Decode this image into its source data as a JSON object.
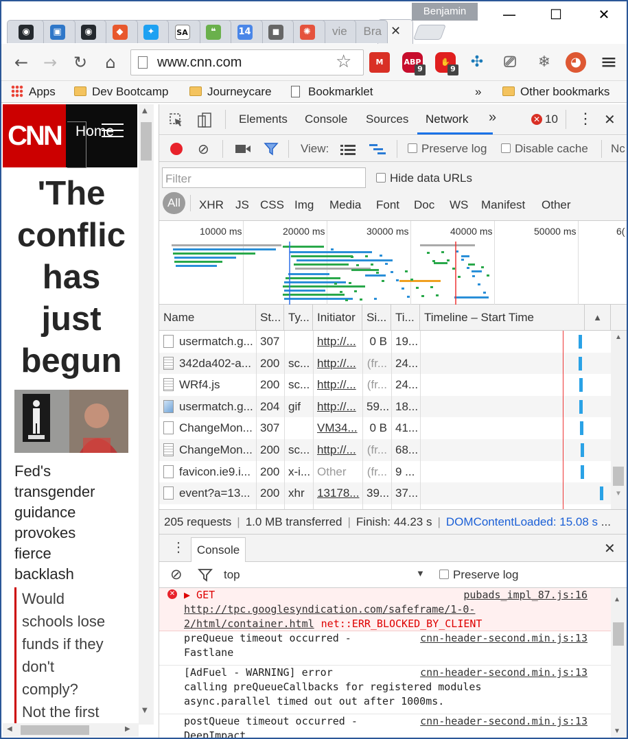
{
  "profile_name": "Benjamin",
  "window_controls": {
    "minimize": "—",
    "maximize": "☐",
    "close": "✕"
  },
  "tabs": [
    {
      "icon": "github-icon",
      "glyph": "◉",
      "color": "#24292e"
    },
    {
      "icon": "blue-app-icon",
      "glyph": "▣",
      "color": "#2f77c8"
    },
    {
      "icon": "github-icon",
      "glyph": "◉",
      "color": "#24292e"
    },
    {
      "icon": "git-icon",
      "glyph": "◆",
      "color": "#e8582d"
    },
    {
      "icon": "twitter-icon",
      "glyph": "✦",
      "color": "#1da1f2"
    },
    {
      "icon": "sa-icon",
      "glyph": "SA",
      "color": "#ffffff"
    },
    {
      "icon": "hangouts-icon",
      "glyph": "❝",
      "color": "#6ab04c"
    },
    {
      "icon": "calendar-icon",
      "glyph": "14",
      "color": "#4a86e8"
    },
    {
      "icon": "box-icon",
      "glyph": "◼",
      "color": "#666666"
    },
    {
      "icon": "wheel-icon",
      "glyph": "✺",
      "color": "#e5533d"
    },
    {
      "text": "vie"
    },
    {
      "text": "Bra"
    }
  ],
  "active_tab_close": "✕",
  "toolbar": {
    "back": "←",
    "forward": "→",
    "reload": "↻",
    "home": "⌂",
    "url": "www.cnn.com",
    "star": "☆",
    "extensions": [
      {
        "name": "gmail-icon",
        "label": "M",
        "color": "#d93025",
        "badge": ""
      },
      {
        "name": "adblock-plus-icon",
        "label": "ABP",
        "color": "#c70d2c",
        "badge": "9"
      },
      {
        "name": "adblock-icon",
        "label": "✋",
        "color": "#e01f1f",
        "badge": "9"
      },
      {
        "name": "network-icon",
        "label": "✣",
        "color": "#1b7ab8",
        "badge": ""
      },
      {
        "name": "cast-icon",
        "label": "⎚",
        "color": "#6b6b6b",
        "badge": ""
      },
      {
        "name": "snowflake-icon",
        "label": "❄",
        "color": "#6b6b6b",
        "badge": ""
      },
      {
        "name": "duckduckgo-icon",
        "label": "◕",
        "color": "#de5833",
        "badge": ""
      }
    ],
    "menu": "≡"
  },
  "bookmarks": {
    "apps": "Apps",
    "items": [
      "Dev Bootcamp",
      "Journeycare",
      "Bookmarklet"
    ],
    "overflow": "»",
    "other": "Other bookmarks"
  },
  "page": {
    "logo": "CNN",
    "nav_home": "Home",
    "headline": [
      "'The",
      "conflic",
      "has",
      "just",
      "begun"
    ],
    "story": [
      "Fed's",
      "transgender",
      "guidance",
      "provokes",
      "fierce",
      "backlash"
    ],
    "related": [
      [
        "Would",
        "schools lose",
        "funds if they",
        "don't",
        "comply?"
      ],
      [
        "Not the first"
      ]
    ]
  },
  "devtools": {
    "tabs": [
      "Elements",
      "Console",
      "Sources",
      "Network"
    ],
    "active_tab": "Network",
    "overflow": "»",
    "error_count": "10",
    "more": "⋮",
    "close": "✕",
    "view_label": "View:",
    "preserve_log": "Preserve log",
    "disable_cache": "Disable cache",
    "nc": "Nc",
    "filter_placeholder": "Filter",
    "hide_data_urls": "Hide data URLs",
    "types": [
      "All",
      "XHR",
      "JS",
      "CSS",
      "Img",
      "Media",
      "Font",
      "Doc",
      "WS",
      "Manifest",
      "Other"
    ],
    "overview_ticks": [
      "10000 ms",
      "20000 ms",
      "30000 ms",
      "40000 ms",
      "50000 ms",
      "6("
    ],
    "columns": [
      "Name",
      "St...",
      "Ty...",
      "Initiator",
      "Si...",
      "Ti...",
      "Timeline – Start Time"
    ],
    "sort_arrow": "▲",
    "requests": [
      {
        "name": "usermatch.g...",
        "status": "307",
        "type": "",
        "initiator": "http://...",
        "size": "0 B",
        "time": "19...",
        "icon": "doc"
      },
      {
        "name": "342da402-a...",
        "status": "200",
        "type": "sc...",
        "initiator": "http://...",
        "size": "(fr...",
        "time": "24...",
        "icon": "script"
      },
      {
        "name": "WRf4.js",
        "status": "200",
        "type": "sc...",
        "initiator": "http://...",
        "size": "(fr...",
        "time": "24...",
        "icon": "script"
      },
      {
        "name": "usermatch.g...",
        "status": "204",
        "type": "gif",
        "initiator": "http://...",
        "size": "59...",
        "time": "18...",
        "icon": "image"
      },
      {
        "name": "ChangeMon...",
        "status": "307",
        "type": "",
        "initiator": "VM34...",
        "size": "0 B",
        "time": "41...",
        "icon": "doc"
      },
      {
        "name": "ChangeMon...",
        "status": "200",
        "type": "sc...",
        "initiator": "http://...",
        "size": "(fr...",
        "time": "68...",
        "icon": "script"
      },
      {
        "name": "favicon.ie9.i...",
        "status": "200",
        "type": "x-i...",
        "initiator": "Other",
        "size": "(fr...",
        "time": "9 ...",
        "icon": "doc"
      },
      {
        "name": "event?a=13...",
        "status": "200",
        "type": "xhr",
        "initiator": "13178...",
        "size": "39...",
        "time": "37...",
        "icon": "doc"
      }
    ],
    "summary": {
      "requests": "205 requests",
      "transferred": "1.0 MB transferred",
      "finish": "Finish: 44.23 s",
      "dcl": "DOMContentLoaded: 15.08 s",
      "more": "..."
    },
    "drawer_tab": "Console",
    "console_context": "top",
    "console_preserve": "Preserve log",
    "console_messages": [
      {
        "level": "error",
        "text": "▶ GET\nhttp://tpc.googlesyndication.com/safeframe/1-0-\n2/html/container.html",
        "err_suffix": "net::ERR_BLOCKED_BY_CLIENT",
        "source": "pubads_impl_87.js:16"
      },
      {
        "level": "log",
        "text": "preQueue timeout occurred -\nFastlane",
        "source": "cnn-header-second.min.js:13"
      },
      {
        "level": "log",
        "text": "[AdFuel - WARNING] error\ncalling preQueueCallbacks for registered modules\nasync.parallel timed out out after 1000ms.",
        "source": "cnn-header-second.min.js:13"
      },
      {
        "level": "log",
        "text": "postQueue timeout occurred -\nDeepImpact",
        "source": "cnn-header-second.min.js:13"
      }
    ]
  },
  "colors": {
    "accent": "#1a73e8",
    "cnn_red": "#cc0000",
    "error_red": "#d93025"
  }
}
